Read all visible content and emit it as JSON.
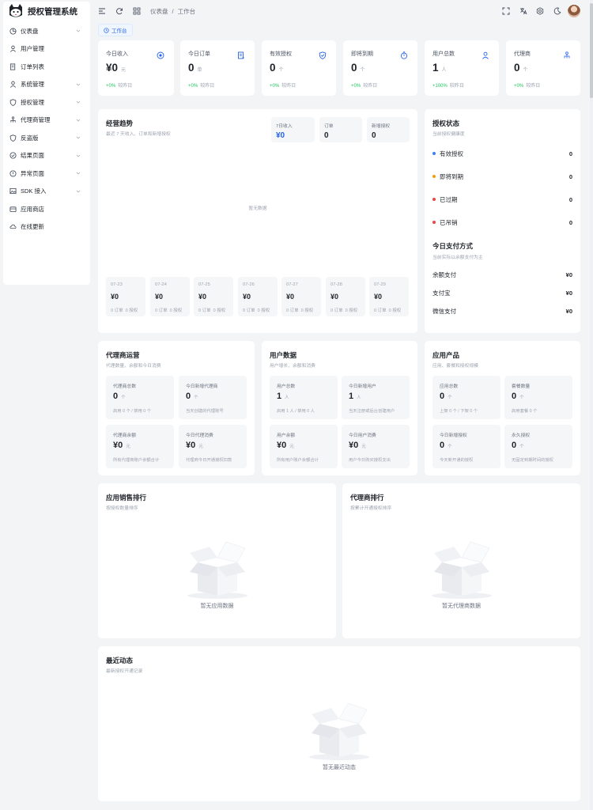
{
  "app": {
    "title": "授权管理系统"
  },
  "sidebar": {
    "items": [
      {
        "label": "仪表盘",
        "icon": "dashboard-icon",
        "has_children": true
      },
      {
        "label": "用户管理",
        "icon": "user-icon",
        "has_children": false
      },
      {
        "label": "订单列表",
        "icon": "order-icon",
        "has_children": false
      },
      {
        "label": "系统管理",
        "icon": "user-icon",
        "has_children": true
      },
      {
        "label": "授权管理",
        "icon": "shield-icon",
        "has_children": true
      },
      {
        "label": "代理商管理",
        "icon": "org-icon",
        "has_children": true
      },
      {
        "label": "反盗版",
        "icon": "shield-icon",
        "has_children": true
      },
      {
        "label": "结果页面",
        "icon": "check-circle-icon",
        "has_children": true
      },
      {
        "label": "异常页面",
        "icon": "alert-circle-icon",
        "has_children": true
      },
      {
        "label": "SDK 接入",
        "icon": "image-icon",
        "has_children": true
      },
      {
        "label": "应用商店",
        "icon": "store-icon",
        "has_children": false
      },
      {
        "label": "在线更新",
        "icon": "cloud-icon",
        "has_children": false
      }
    ]
  },
  "header": {
    "breadcrumb": [
      "仪表盘",
      "工作台"
    ],
    "tab": "工作台"
  },
  "stats": [
    {
      "label": "今日收入",
      "value": "¥0",
      "unit": "元",
      "change": "+0%",
      "foot": "较昨日",
      "icon": "coin-icon"
    },
    {
      "label": "今日订单",
      "value": "0",
      "unit": "单",
      "change": "+0%",
      "foot": "较昨日",
      "icon": "order-icon"
    },
    {
      "label": "有效授权",
      "value": "0",
      "unit": "个",
      "change": "+0%",
      "foot": "较昨日",
      "icon": "shield-icon"
    },
    {
      "label": "即将到期",
      "value": "0",
      "unit": "个",
      "change": "+0%",
      "foot": "较昨日",
      "icon": "timer-icon"
    },
    {
      "label": "用户总数",
      "value": "1",
      "unit": "人",
      "change": "+100%",
      "foot": "较昨日",
      "icon": "user-icon"
    },
    {
      "label": "代理商",
      "value": "0",
      "unit": "个",
      "change": "+0%",
      "foot": "较昨日",
      "icon": "org-icon"
    }
  ],
  "trend": {
    "title": "经营趋势",
    "subtitle": "最近 7 天收入、订单和新增授权",
    "summary": [
      {
        "label": "7日收入",
        "value": "¥0"
      },
      {
        "label": "订单",
        "value": "0"
      },
      {
        "label": "新增授权",
        "value": "0"
      }
    ],
    "empty_text": "暂无数据",
    "days": [
      {
        "date": "07-23",
        "value": "¥0",
        "orders": "0 订单",
        "auths": "0 授权"
      },
      {
        "date": "07-24",
        "value": "¥0",
        "orders": "0 订单",
        "auths": "0 授权"
      },
      {
        "date": "07-25",
        "value": "¥0",
        "orders": "0 订单",
        "auths": "0 授权"
      },
      {
        "date": "07-26",
        "value": "¥0",
        "orders": "0 订单",
        "auths": "0 授权"
      },
      {
        "date": "07-27",
        "value": "¥0",
        "orders": "0 订单",
        "auths": "0 授权"
      },
      {
        "date": "07-28",
        "value": "¥0",
        "orders": "0 订单",
        "auths": "0 授权"
      },
      {
        "date": "07-29",
        "value": "¥0",
        "orders": "0 订单",
        "auths": "0 授权"
      }
    ]
  },
  "auth_status": {
    "title": "授权状态",
    "subtitle": "当前授权健康度",
    "rows": [
      {
        "label": "有效授权",
        "value": "0",
        "color": "#3b82f6"
      },
      {
        "label": "即将到期",
        "value": "0",
        "color": "#f59e0b"
      },
      {
        "label": "已过期",
        "value": "0",
        "color": "#ef4444"
      },
      {
        "label": "已吊销",
        "value": "0",
        "color": "#ef4444"
      }
    ],
    "pay_title": "今日支付方式",
    "pay_subtitle": "当前实际以余额支付为主",
    "pay_rows": [
      {
        "label": "余额支付",
        "value": "¥0"
      },
      {
        "label": "支付宝",
        "value": "¥0"
      },
      {
        "label": "微信支付",
        "value": "¥0"
      }
    ]
  },
  "agent_ops": {
    "title": "代理商运营",
    "subtitle": "代理数量、余额和今日消费",
    "boxes": [
      {
        "label": "代理商总数",
        "value": "0",
        "unit": "个",
        "foot": "启用 0 个 / 禁用 0 个"
      },
      {
        "label": "今日新增代理商",
        "value": "0",
        "unit": "个",
        "foot": "当天创建的代理账号"
      },
      {
        "label": "代理商余额",
        "value": "¥0",
        "unit": "元",
        "foot": "所有代理商账户余额合计"
      },
      {
        "label": "今日代理消费",
        "value": "¥0",
        "unit": "元",
        "foot": "代理商今日开通授权扣款"
      }
    ]
  },
  "user_data": {
    "title": "用户数据",
    "subtitle": "用户增长、余额和消费",
    "boxes": [
      {
        "label": "用户总数",
        "value": "1",
        "unit": "人",
        "foot": "启用 1 人 / 禁用 0 人"
      },
      {
        "label": "今日新增用户",
        "value": "1",
        "unit": "人",
        "foot": "当天注册或后台创建用户"
      },
      {
        "label": "用户余额",
        "value": "¥0",
        "unit": "元",
        "foot": "所有用户账户余额合计"
      },
      {
        "label": "今日用户消费",
        "value": "¥0",
        "unit": "元",
        "foot": "用户今日购买授权支出"
      }
    ]
  },
  "app_products": {
    "title": "应用产品",
    "subtitle": "应用、套餐和授权规模",
    "boxes": [
      {
        "label": "应用总数",
        "value": "0",
        "unit": "个",
        "foot": "上架 0 个 / 下架 0 个"
      },
      {
        "label": "套餐数量",
        "value": "0",
        "unit": "个",
        "foot": "启用套餐 0 个"
      },
      {
        "label": "今日新增授权",
        "value": "0",
        "unit": "个",
        "foot": "今天新开通的授权"
      },
      {
        "label": "永久授权",
        "value": "0",
        "unit": "个",
        "foot": "无固定到期时间的授权"
      }
    ]
  },
  "app_ranking": {
    "title": "应用销售排行",
    "subtitle": "按授权数量排序",
    "empty": "暂无应用数据"
  },
  "agent_ranking": {
    "title": "代理商排行",
    "subtitle": "按累计开通授权排序",
    "empty": "暂无代理商数据"
  },
  "recent": {
    "title": "最近动态",
    "subtitle": "最新授权开通记录",
    "empty": "暂无最近动态"
  },
  "colors": {
    "accent": "#2563eb",
    "positive": "#22c55e",
    "danger": "#ef4444",
    "warning": "#f59e0b"
  }
}
